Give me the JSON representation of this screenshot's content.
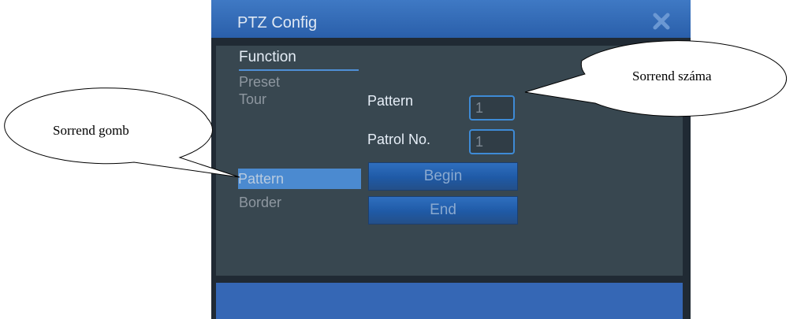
{
  "dialog": {
    "title": "PTZ Config",
    "close_icon": "close-x-icon"
  },
  "menu": {
    "heading": "Function",
    "items": [
      "Preset",
      "Tour",
      "Pattern",
      "Border"
    ],
    "selected": "Pattern"
  },
  "form": {
    "pattern_label": "Pattern",
    "pattern_value": "1",
    "patrol_label": "Patrol No.",
    "patrol_value": "1",
    "begin_button": "Begin",
    "end_button": "End"
  },
  "callouts": {
    "pattern_button": "Sorrend gomb",
    "pattern_number": "Sorrend száma"
  },
  "colors": {
    "title_bar": "#3568b5",
    "panel": "#384750",
    "selected_item": "#4b8ad0",
    "field_border": "#3e8bd6"
  }
}
